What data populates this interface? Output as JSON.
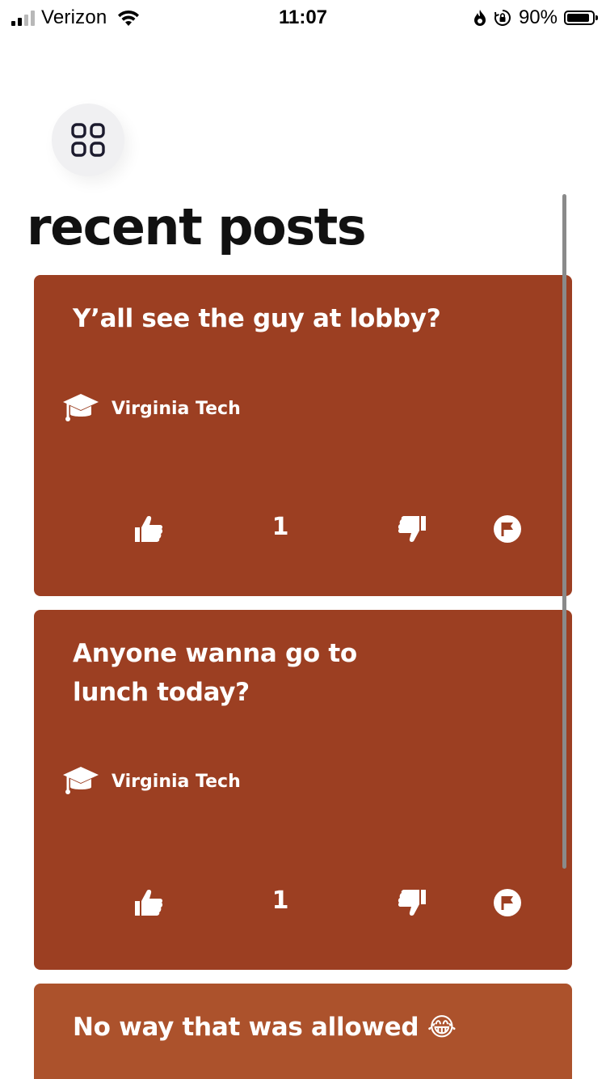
{
  "status_bar": {
    "carrier": "Verizon",
    "time": "11:07",
    "battery_percent": "90%",
    "battery_level": 0.9,
    "signal_bars": 2
  },
  "header": {
    "menu_icon": "grid-icon",
    "title": "recent posts"
  },
  "posts": [
    {
      "text": "Y’all see the guy at lobby?",
      "school": "Virginia Tech",
      "votes": "1",
      "color": "#9c3f22"
    },
    {
      "text": "Anyone wanna go to lunch today?",
      "school": "Virginia Tech",
      "votes": "1",
      "color": "#9c3f22"
    },
    {
      "text": "No way that was allowed 😂",
      "color": "#ac522c"
    }
  ],
  "icons": {
    "like": "thumbs-up-icon",
    "dislike": "thumbs-down-icon",
    "flag": "flag-icon",
    "school": "graduation-cap-icon"
  },
  "colors": {
    "card": "#9c3f22",
    "card_alt": "#ac522c",
    "title": "#111111"
  }
}
